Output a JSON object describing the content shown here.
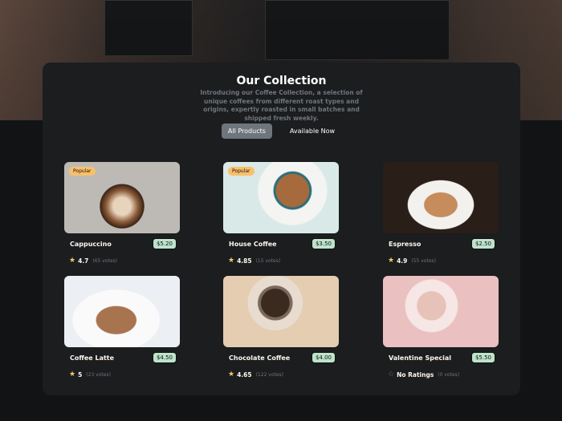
{
  "header": {
    "title": "Our Collection",
    "description": "Introducing our Coffee Collection, a selection of unique coffees from different roast types and origins, expertly roasted in small batches and shipped fresh weekly."
  },
  "tabs": [
    {
      "label": "All Products",
      "active": true
    },
    {
      "label": "Available Now",
      "active": false
    }
  ],
  "products": [
    {
      "name": "Cappuccino",
      "price": "$5.20",
      "rating": "4.7",
      "votes": "(65 votes)",
      "badge": "Popular"
    },
    {
      "name": "House Coffee",
      "price": "$3.50",
      "rating": "4.85",
      "votes": "(15 votes)",
      "badge": "Popular"
    },
    {
      "name": "Espresso",
      "price": "$2.50",
      "rating": "4.9",
      "votes": "(55 votes)"
    },
    {
      "name": "Coffee Latte",
      "price": "$4.50",
      "rating": "5",
      "votes": "(23 votes)"
    },
    {
      "name": "Chocolate Coffee",
      "price": "$4.00",
      "rating": "4.65",
      "votes": "(122 votes)"
    },
    {
      "name": "Valentine Special",
      "price": "$5.50",
      "rating": "No Ratings",
      "votes": "(0 votes)"
    }
  ]
}
